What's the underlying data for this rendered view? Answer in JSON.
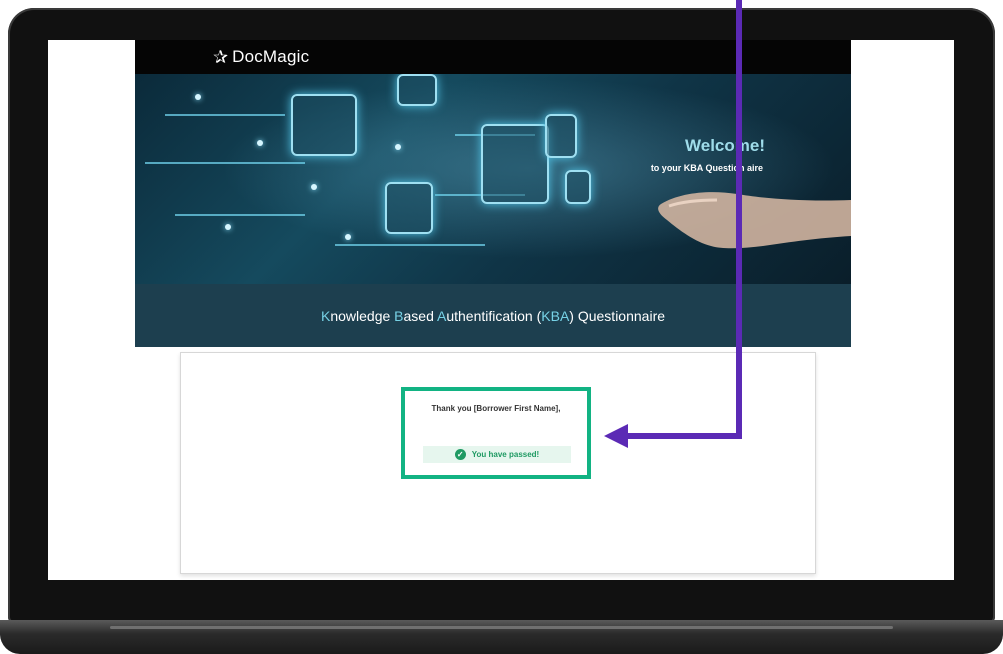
{
  "topbar": {
    "logo_text": "DocMagic",
    "logo_icon": "star-icon"
  },
  "hero": {
    "welcome_title": "Welcome!",
    "welcome_subtitle": "to your KBA Question aire"
  },
  "kba": {
    "title_parts": [
      {
        "text": "K",
        "highlight": true
      },
      {
        "text": "nowledge ",
        "highlight": false
      },
      {
        "text": "B",
        "highlight": true
      },
      {
        "text": "ased ",
        "highlight": false
      },
      {
        "text": "A",
        "highlight": true
      },
      {
        "text": "uthentification (",
        "highlight": false
      },
      {
        "text": "KBA",
        "highlight": true
      },
      {
        "text": ") Questionnaire",
        "highlight": false
      }
    ]
  },
  "result": {
    "thank_you": "Thank you [Borrower First Name],",
    "status": "You have passed!",
    "status_icon": "check-circle-icon"
  },
  "colors": {
    "accent_green": "#12b383",
    "arrow_purple": "#5b2ab5",
    "kba_highlight": "#77d2e6"
  }
}
